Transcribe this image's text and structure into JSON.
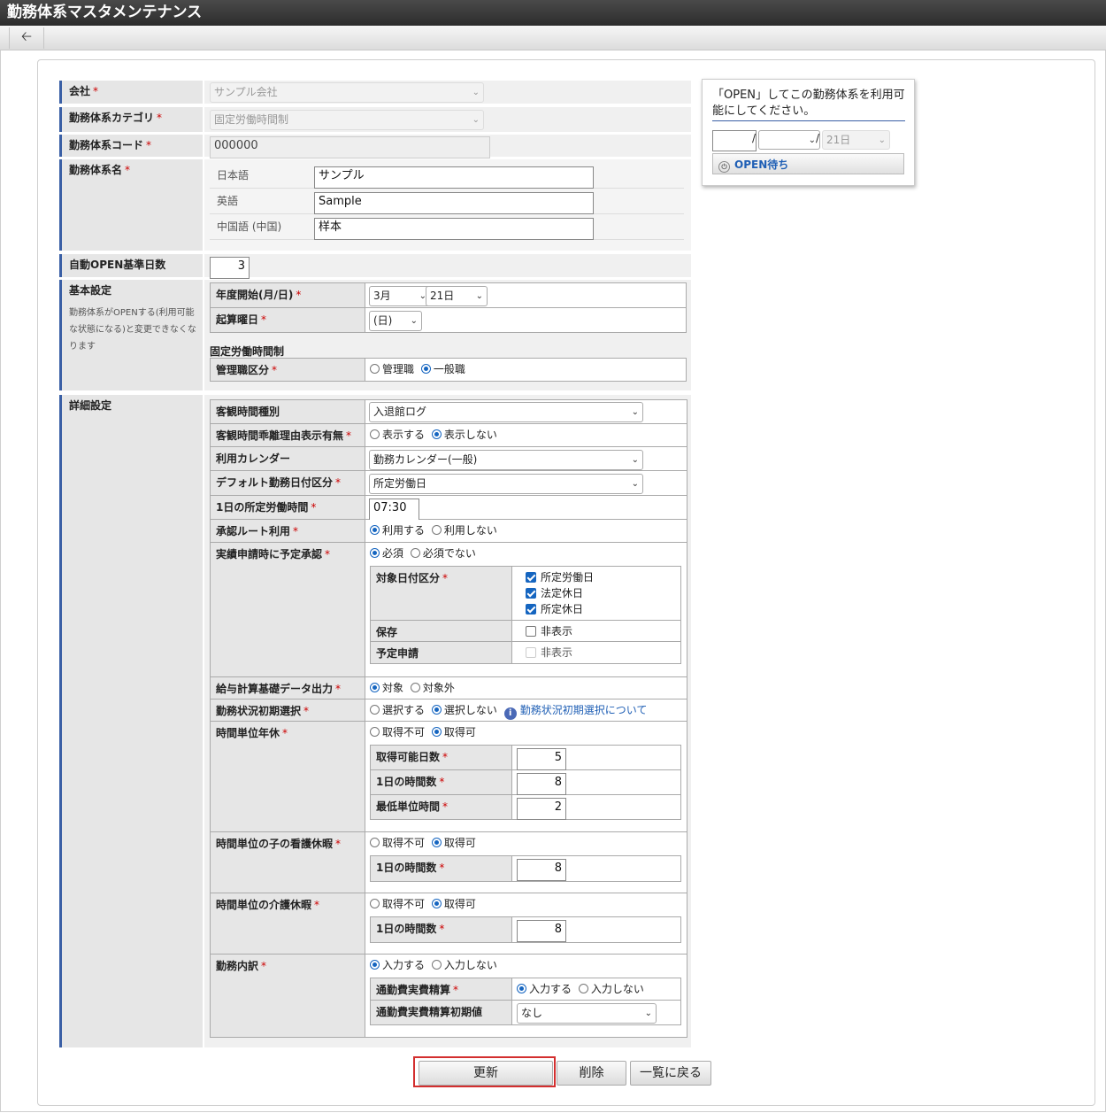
{
  "title": "勤務体系マスタメンテナンス",
  "toolbar": {
    "back_icon": "arrow-left-icon"
  },
  "required_mark": "*",
  "company": {
    "label": "会社",
    "value": "サンプル会社"
  },
  "category": {
    "label": "勤務体系カテゴリ",
    "value": "固定労働時間制"
  },
  "code": {
    "label": "勤務体系コード",
    "value": "000000"
  },
  "name": {
    "label": "勤務体系名",
    "langs": [
      {
        "lang": "日本語",
        "value": "サンプル"
      },
      {
        "lang": "英語",
        "value": "Sample"
      },
      {
        "lang": "中国語 (中国)",
        "value": "样本"
      }
    ]
  },
  "auto_open": {
    "label": "自動OPEN基準日数",
    "value": "3"
  },
  "basic": {
    "label": "基本設定",
    "note": "勤務体系がOPENする(利用可能な状態になる)と変更できなくなります",
    "fiscal_start": {
      "label": "年度開始(月/日)",
      "month": "3月",
      "day": "21日"
    },
    "start_weekday": {
      "label": "起算曜日",
      "value": "(日)"
    },
    "fixed_heading": "固定労働時間制",
    "manager": {
      "label": "管理職区分",
      "opt1": "管理職",
      "opt2": "一般職"
    }
  },
  "detail": {
    "label": "詳細設定",
    "objective_type": {
      "label": "客観時間種別",
      "value": "入退館ログ"
    },
    "objective_reason": {
      "label": "客観時間乖離理由表示有無",
      "opt1": "表示する",
      "opt2": "表示しない"
    },
    "calendar": {
      "label": "利用カレンダー",
      "value": "勤務カレンダー(一般)"
    },
    "default_date": {
      "label": "デフォルト勤務日付区分",
      "value": "所定労働日"
    },
    "daily_hours": {
      "label": "1日の所定労働時間",
      "value": "07:30"
    },
    "approval_route": {
      "label": "承認ルート利用",
      "opt1": "利用する",
      "opt2": "利用しない"
    },
    "plan_approval": {
      "label": "実績申請時に予定承認",
      "opt1": "必須",
      "opt2": "必須でない",
      "target_label": "対象日付区分",
      "targets": [
        "所定労働日",
        "法定休日",
        "所定休日"
      ],
      "save_label": "保存",
      "save_opt": "非表示",
      "plan_label": "予定申請",
      "plan_opt": "非表示"
    },
    "payroll": {
      "label": "給与計算基礎データ出力",
      "opt1": "対象",
      "opt2": "対象外"
    },
    "status_init": {
      "label": "勤務状況初期選択",
      "opt1": "選択する",
      "opt2": "選択しない",
      "link": "勤務状況初期選択について"
    },
    "hourly_leave": {
      "label": "時間単位年休",
      "opt1": "取得不可",
      "opt2": "取得可",
      "days_label": "取得可能日数",
      "days": "5",
      "hours_label": "1日の時間数",
      "hours": "8",
      "min_label": "最低単位時間",
      "min": "2"
    },
    "child_care": {
      "label": "時間単位の子の看護休暇",
      "opt1": "取得不可",
      "opt2": "取得可",
      "hours_label": "1日の時間数",
      "hours": "8"
    },
    "nursing_care": {
      "label": "時間単位の介護休暇",
      "opt1": "取得不可",
      "opt2": "取得可",
      "hours_label": "1日の時間数",
      "hours": "8"
    },
    "breakdown": {
      "label": "勤務内訳",
      "opt1": "入力する",
      "opt2": "入力しない",
      "commute_label": "通勤費実費精算",
      "commute_opt1": "入力する",
      "commute_opt2": "入力しない",
      "commute_init_label": "通勤費実費精算初期値",
      "commute_init": "なし"
    }
  },
  "open_box": {
    "message": "「OPEN」してこの勤務体系を利用可能にしてください。",
    "year": "",
    "month": "",
    "day": "21日",
    "sep": "/",
    "button": "OPEN待ち"
  },
  "buttons": {
    "update": "更新",
    "delete": "削除",
    "back": "一覧に戻る"
  },
  "highlight_color": "#d32f2f",
  "accent_color": "#3a5fa5"
}
